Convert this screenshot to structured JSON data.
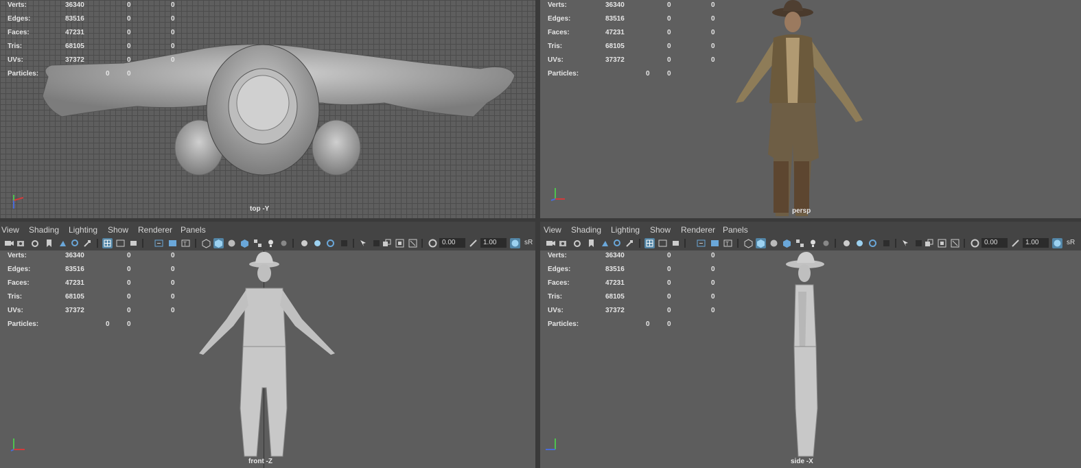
{
  "stats": {
    "rows": [
      {
        "label": "Verts:",
        "v1": "36340",
        "v2": "0",
        "v3": "0"
      },
      {
        "label": "Edges:",
        "v1": "83516",
        "v2": "0",
        "v3": "0"
      },
      {
        "label": "Faces:",
        "v1": "47231",
        "v2": "0",
        "v3": "0"
      },
      {
        "label": "Tris:",
        "v1": "68105",
        "v2": "0",
        "v3": "0"
      },
      {
        "label": "UVs:",
        "v1": "37372",
        "v2": "0",
        "v3": "0"
      }
    ],
    "particles": {
      "label": "Particles:",
      "v2": "0",
      "v3": "0"
    }
  },
  "viewports": {
    "top": {
      "camera": "top -Y"
    },
    "persp": {
      "camera": "persp"
    },
    "front": {
      "camera": "front -Z"
    },
    "side": {
      "camera": "side -X"
    }
  },
  "panel_menu": [
    "View",
    "Shading",
    "Lighting",
    "Show",
    "Renderer",
    "Panels"
  ],
  "toolbar": {
    "field1": "0.00",
    "field2": "1.00",
    "badge": "sR"
  },
  "icons": {
    "toolbar": [
      "camera-icon",
      "camera-attr-icon",
      "bookmark-icon",
      "image-plane-icon",
      "grid-icon",
      "film-gate-icon",
      "resolution-gate-icon",
      "field-chart-icon",
      "safe-action-icon",
      "wireframe-icon",
      "smooth-shade-icon",
      "textured-icon",
      "lights-icon",
      "shadows-icon",
      "ambient-occlusion-icon",
      "motion-blur-icon",
      "anti-alias-icon",
      "isolate-icon",
      "xray-icon",
      "xray-joints-icon",
      "exposure-icon",
      "gamma-icon",
      "color-manage-icon"
    ]
  },
  "colors": {
    "toolbar_active": "#5285a6",
    "viewport_bg": "#5d5d5d",
    "axis_x": "#d23b3b",
    "axis_y": "#4fc24f",
    "axis_z": "#4a6bd8"
  }
}
